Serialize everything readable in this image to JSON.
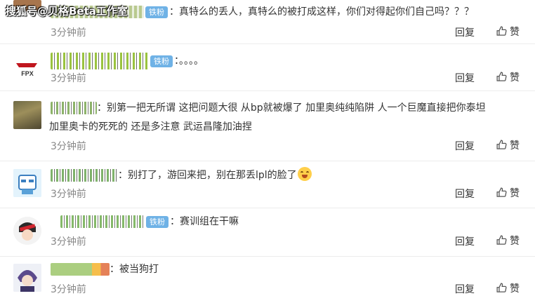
{
  "watermark": "搜狐号@贝格Beta工作室",
  "badge_label": "铁粉",
  "reply_label": "回复",
  "like_label": "赞",
  "comments": [
    {
      "text": "：真特么的丢人，真特么的被打成这样，你们对得起你们自己吗？？？",
      "time": "3分钟前"
    },
    {
      "text": "：。。。。",
      "time": "3分钟前"
    },
    {
      "text": "：别第一把无所谓 这把问题大很 从bp就被爆了 加里奥纯纯陷阱 人一个巨魔直接把你泰坦",
      "text2": "加里奥卡的死死的 还是多注意 武运昌隆加油捏",
      "time": "3分钟前"
    },
    {
      "text": "：别打了，游回来把，别在那丢lpl的脸了",
      "time": "3分钟前"
    },
    {
      "text": "：赛训组在干嘛",
      "time": "3分钟前"
    },
    {
      "text": "：被当狗打",
      "time": "3分钟前"
    }
  ],
  "avatar_logo_text": "FPX",
  "colors": {
    "badge": "#6fb2e6",
    "time": "#888888",
    "divider": "#ececec"
  },
  "icons": [
    "thumbs-up-icon",
    "grin-emoji-icon"
  ]
}
